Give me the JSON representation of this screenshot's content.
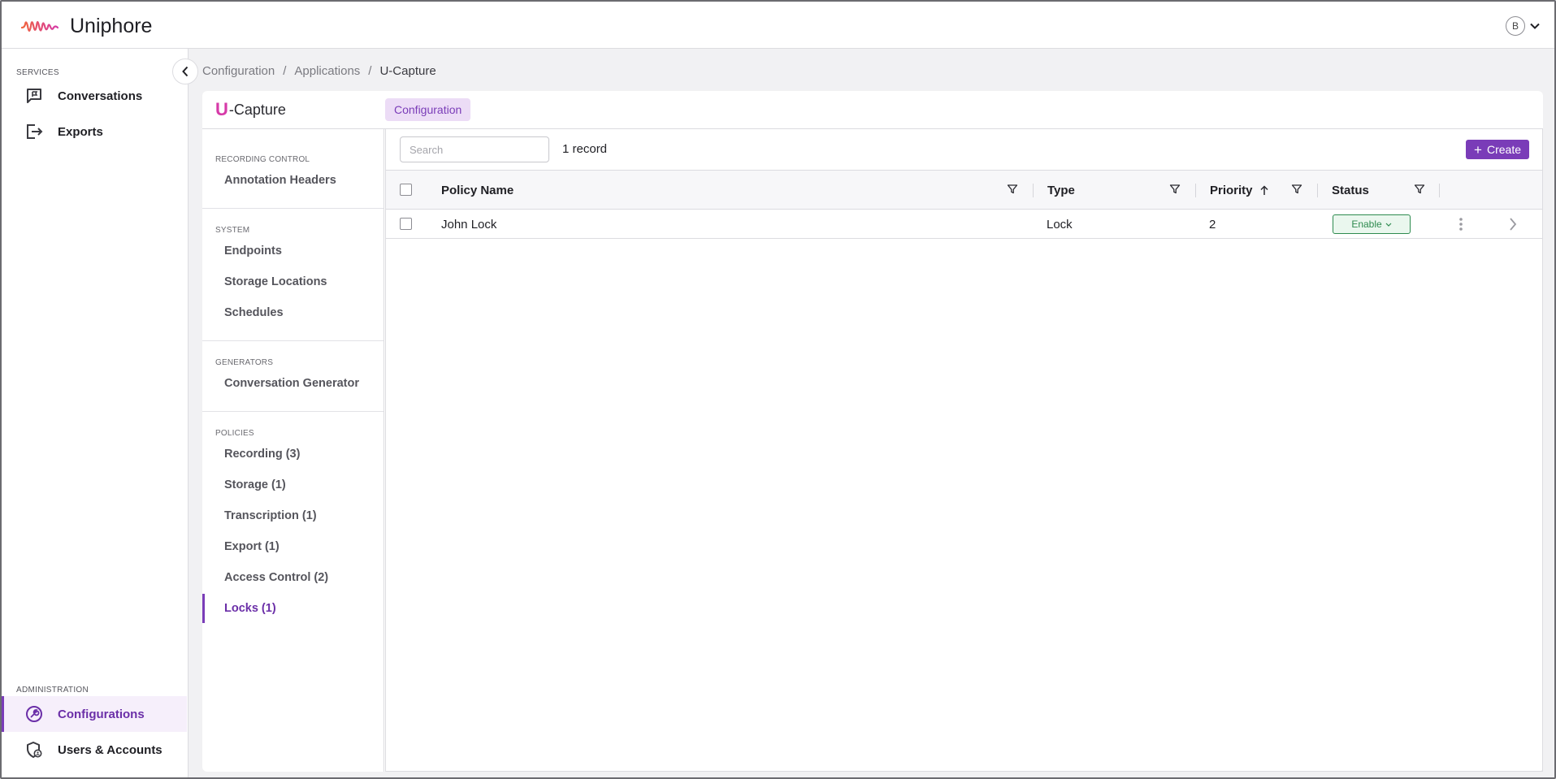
{
  "app": {
    "name": "Uniphore"
  },
  "user": {
    "initial": "B"
  },
  "nav": {
    "services_label": "SERVICES",
    "services": [
      {
        "label": "Conversations",
        "icon": "chat-flag-icon"
      },
      {
        "label": "Exports",
        "icon": "export-icon"
      }
    ],
    "admin_label": "ADMINISTRATION",
    "admin": [
      {
        "label": "Configurations",
        "icon": "config-wrench-icon",
        "active": true
      },
      {
        "label": "Users & Accounts",
        "icon": "user-shield-icon"
      }
    ]
  },
  "breadcrumb": [
    "Configuration",
    "Applications",
    "U-Capture"
  ],
  "breadcrumb_separator": "/",
  "card": {
    "app_title_prefix": "U",
    "app_title_rest": "-Capture",
    "tab": "Configuration"
  },
  "subnav": {
    "sections": [
      {
        "label": "RECORDING CONTROL",
        "items": [
          "Annotation Headers"
        ]
      },
      {
        "label": "SYSTEM",
        "items": [
          "Endpoints",
          "Storage Locations",
          "Schedules"
        ]
      },
      {
        "label": "GENERATORS",
        "items": [
          "Conversation Generator"
        ]
      },
      {
        "label": "POLICIES",
        "items": [
          "Recording (3)",
          "Storage (1)",
          "Transcription (1)",
          "Export (1)",
          "Access Control (2)",
          "Locks (1)"
        ]
      }
    ],
    "active_item": "Locks (1)"
  },
  "toolbar": {
    "search_placeholder": "Search",
    "record_count": "1 record",
    "create_label": "Create"
  },
  "table": {
    "columns": [
      "Policy Name",
      "Type",
      "Priority",
      "Status"
    ],
    "sort": {
      "column": "Priority",
      "direction": "ascending"
    },
    "rows": [
      {
        "policy_name": "John Lock",
        "type": "Lock",
        "priority": "2",
        "status": "Enable"
      }
    ]
  },
  "colors": {
    "accent": "#7a3cb8",
    "accent_light": "#ecdcf6",
    "status_green": "#2e8b4f",
    "brand_pink": "#d63aa8"
  }
}
